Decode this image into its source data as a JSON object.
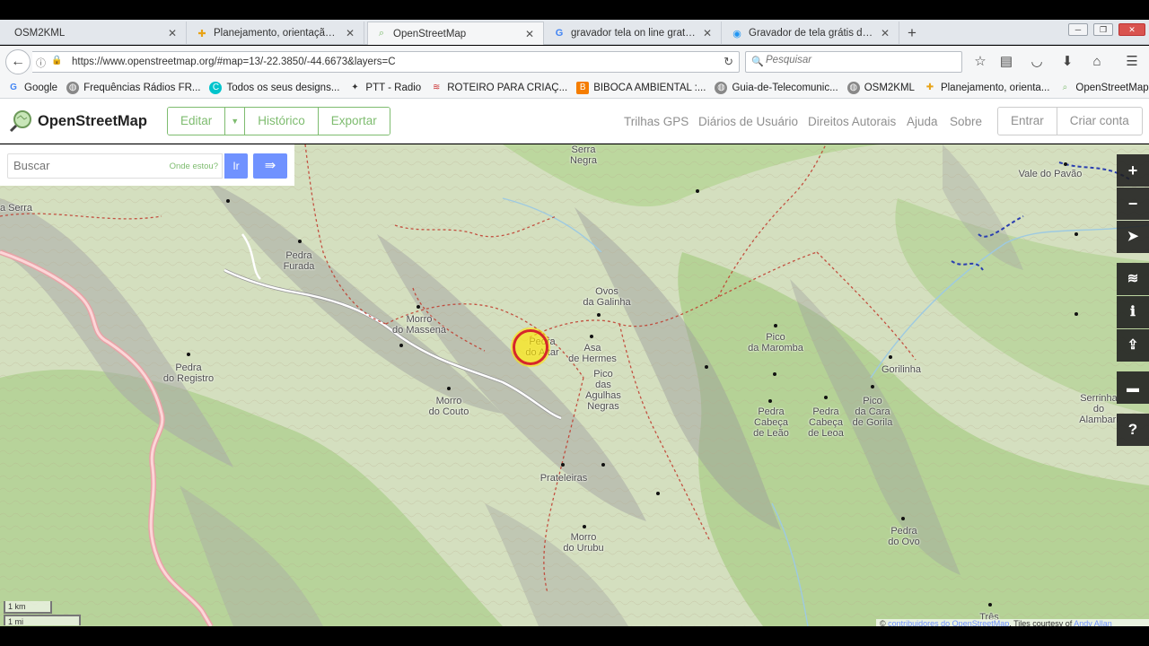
{
  "browser": {
    "tabs": [
      {
        "title": "OSM2KML",
        "icon": "page-icon",
        "active": false
      },
      {
        "title": "Planejamento, orientação e n",
        "icon": "planning-favicon",
        "active": false
      },
      {
        "title": "OpenStreetMap",
        "icon": "osm-favicon",
        "active": true
      },
      {
        "title": "gravador tela on line gratis - ",
        "icon": "google-favicon",
        "active": false
      },
      {
        "title": "Gravador de tela grátis da Ap",
        "icon": "apowersoft-favicon",
        "active": false
      }
    ],
    "url": "https://www.openstreetmap.org/#map=13/-22.3850/-44.6673&layers=C",
    "search_placeholder": "Pesquisar",
    "bookmarks": [
      {
        "label": "Google",
        "icon": "google-icon",
        "color": "#4285f4"
      },
      {
        "label": "Frequências Rádios FR...",
        "icon": "globe-icon",
        "color": "#666666"
      },
      {
        "label": "Todos os seus designs...",
        "icon": "canva-icon",
        "color": "#00c4cc"
      },
      {
        "label": "PTT - Radio",
        "icon": "radio-icon",
        "color": "#333333"
      },
      {
        "label": "ROTEIRO PARA CRIAÇ...",
        "icon": "map-icon",
        "color": "#cc3333"
      },
      {
        "label": "BIBOCA AMBIENTAL :...",
        "icon": "blogger-icon",
        "color": "#f57d00"
      },
      {
        "label": "Guia-de-Telecomunic...",
        "icon": "globe-icon",
        "color": "#666666"
      },
      {
        "label": "OSM2KML",
        "icon": "globe-icon",
        "color": "#666666"
      },
      {
        "label": "Planejamento, orienta...",
        "icon": "planning-icon",
        "color": "#e8a317"
      },
      {
        "label": "OpenStreetMap | Expo...",
        "icon": "osm-icon",
        "color": "#7ebc6f"
      }
    ]
  },
  "osm": {
    "title": "OpenStreetMap",
    "edit_label": "Editar",
    "history_label": "Histórico",
    "export_label": "Exportar",
    "links": [
      "Trilhas GPS",
      "Diários de Usuário",
      "Direitos Autorais",
      "Ajuda",
      "Sobre"
    ],
    "login_label": "Entrar",
    "signup_label": "Criar conta",
    "search_placeholder": "Buscar",
    "where_am_i": "Onde estou?",
    "go_label": "Ir",
    "accent": "#7ebc6f",
    "button_blue": "#7092ff"
  },
  "map": {
    "labels": [
      {
        "text": "Serra\nNegra"
      },
      {
        "text": "Vale do Pavão"
      },
      {
        "text": "a Serra"
      },
      {
        "text": "Pedra\nFurada"
      },
      {
        "text": "Ovos\nda Galinha"
      },
      {
        "text": "Morro\ndo Massena"
      },
      {
        "text": "Pedra\ndo Altar"
      },
      {
        "text": "Asa\nde Hermes"
      },
      {
        "text": "Pico\nda Maromba"
      },
      {
        "text": "Gorilinha"
      },
      {
        "text": "Pedra\ndo Registro"
      },
      {
        "text": "Pico\ndas\nAgulhas\nNegras"
      },
      {
        "text": "Morro\ndo Couto"
      },
      {
        "text": "Pedra\nCabeça\nde Leão"
      },
      {
        "text": "Pedra\nCabeça\nde Leoa"
      },
      {
        "text": "Pico\nda Cara\nde Gorila"
      },
      {
        "text": "Serrinha do Alambari"
      },
      {
        "text": "Prateleiras"
      },
      {
        "text": "Morro\ndo Urubu"
      },
      {
        "text": "Pedra\ndo Ovo"
      },
      {
        "text": "Três"
      }
    ],
    "scale_km": "1 km",
    "scale_mi": "1 mi",
    "attribution_prefix": "© ",
    "attribution_link": "contribuidores do OpenStreetMap",
    "attribution_suffix": ". Tiles courtesy of ",
    "attribution_link2": "Andy Allan"
  }
}
